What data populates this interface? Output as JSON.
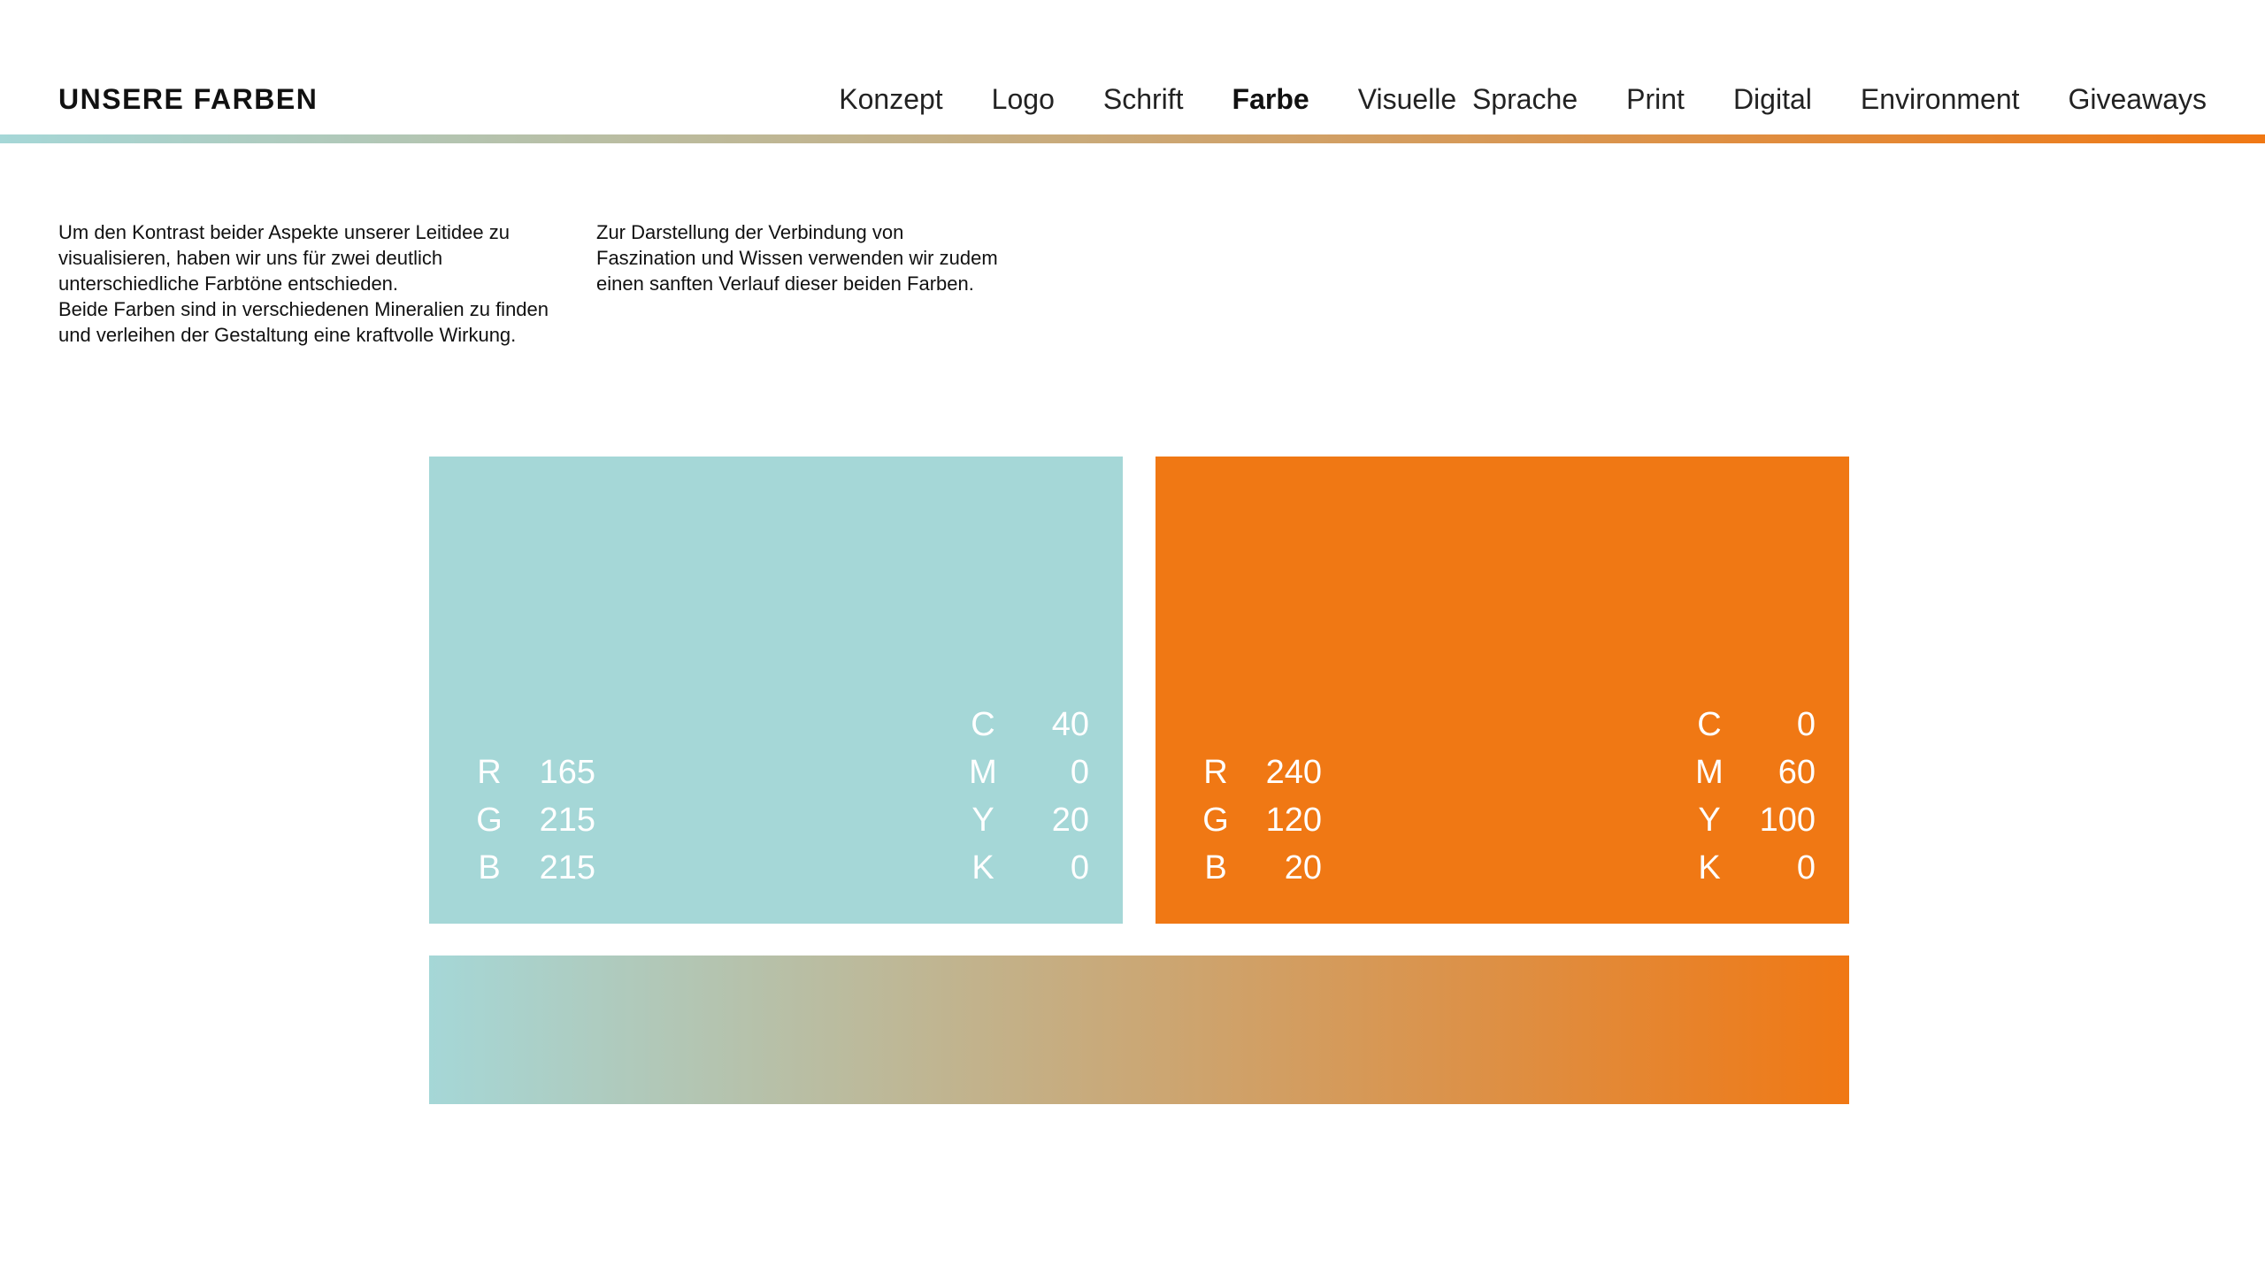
{
  "header": {
    "title": "UNSERE FARBEN",
    "nav": [
      {
        "label": "Konzept",
        "active": false
      },
      {
        "label": "Logo",
        "active": false
      },
      {
        "label": "Schrift",
        "active": false
      },
      {
        "label": "Farbe",
        "active": true
      },
      {
        "label": "Visuelle  Sprache",
        "active": false
      },
      {
        "label": "Print",
        "active": false
      },
      {
        "label": "Digital",
        "active": false
      },
      {
        "label": "Environment",
        "active": false
      },
      {
        "label": "Giveaways",
        "active": false
      }
    ]
  },
  "intro": {
    "left": "Um den Kontrast beider Aspekte unserer Leitidee zu\nvisualisieren, haben wir uns für zwei deutlich\nunterschiedliche Farbtöne entschieden.\nBeide Farben sind in verschiedenen Mineralien zu finden\nund verleihen der Gestaltung eine kraftvolle Wirkung.",
    "right": "Zur Darstellung der Verbindung von\n Faszination und Wissen verwenden wir zudem\n einen sanften Verlauf dieser beiden Farben."
  },
  "colors": {
    "teal": {
      "hex": "#A5D7D7",
      "rgb": [
        {
          "key": "R",
          "value": "165"
        },
        {
          "key": "G",
          "value": "215"
        },
        {
          "key": "B",
          "value": "215"
        }
      ],
      "cmyk": [
        {
          "key": "C",
          "value": "40"
        },
        {
          "key": "M",
          "value": "0"
        },
        {
          "key": "Y",
          "value": "20"
        },
        {
          "key": "K",
          "value": "0"
        }
      ]
    },
    "orange": {
      "hex": "#F07814",
      "rgb": [
        {
          "key": "R",
          "value": "240"
        },
        {
          "key": "G",
          "value": "120"
        },
        {
          "key": "B",
          "value": "20"
        }
      ],
      "cmyk": [
        {
          "key": "C",
          "value": "0"
        },
        {
          "key": "M",
          "value": "60"
        },
        {
          "key": "Y",
          "value": "100"
        },
        {
          "key": "K",
          "value": "0"
        }
      ]
    }
  },
  "gradient": {
    "from": "#A5D7D7",
    "to": "#F07814"
  }
}
